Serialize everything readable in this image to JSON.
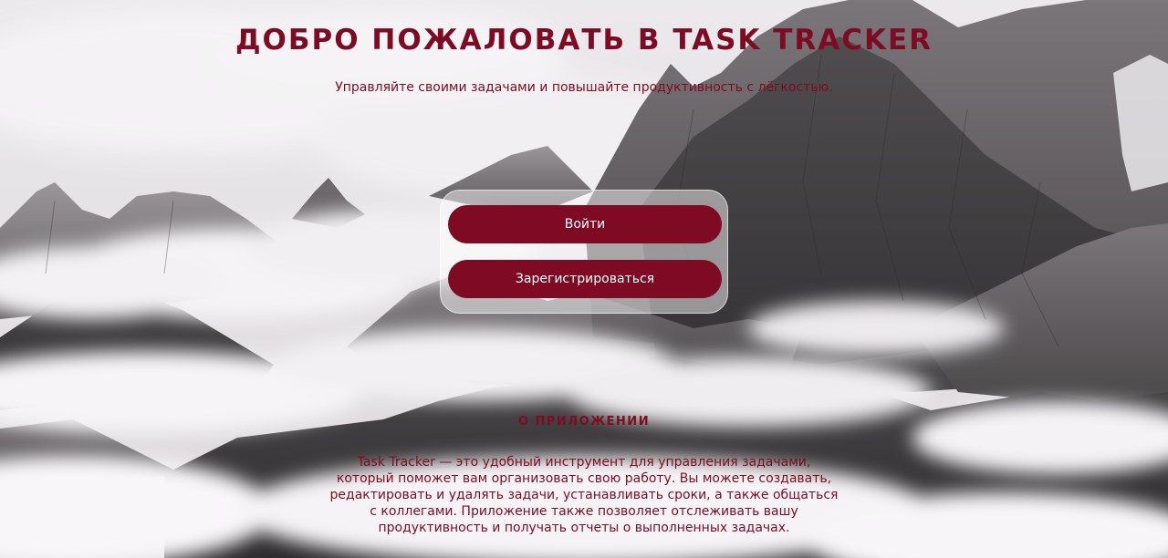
{
  "hero": {
    "title": "ДОБРО ПОЖАЛОВАТЬ В TASK TRACKER",
    "subtitle": "Управляйте своими задачами и повышайте продуктивность с лёгкостью."
  },
  "auth": {
    "login_label": "Войти",
    "register_label": "Зарегистрироваться"
  },
  "about": {
    "title": "О ПРИЛОЖЕНИИ",
    "text": "Task Tracker — это удобный инструмент для управления задачами, который поможет вам организовать свою работу. Вы можете создавать, редактировать и удалять задачи, устанавливать сроки, а также общаться с коллегами. Приложение также позволяет отслеживать вашу продуктивность и получать отчеты о выполненных задачах."
  },
  "colors": {
    "accent": "#7e0b23",
    "button_text": "#ffffff"
  },
  "background": {
    "description_icon": "mountains-background"
  }
}
